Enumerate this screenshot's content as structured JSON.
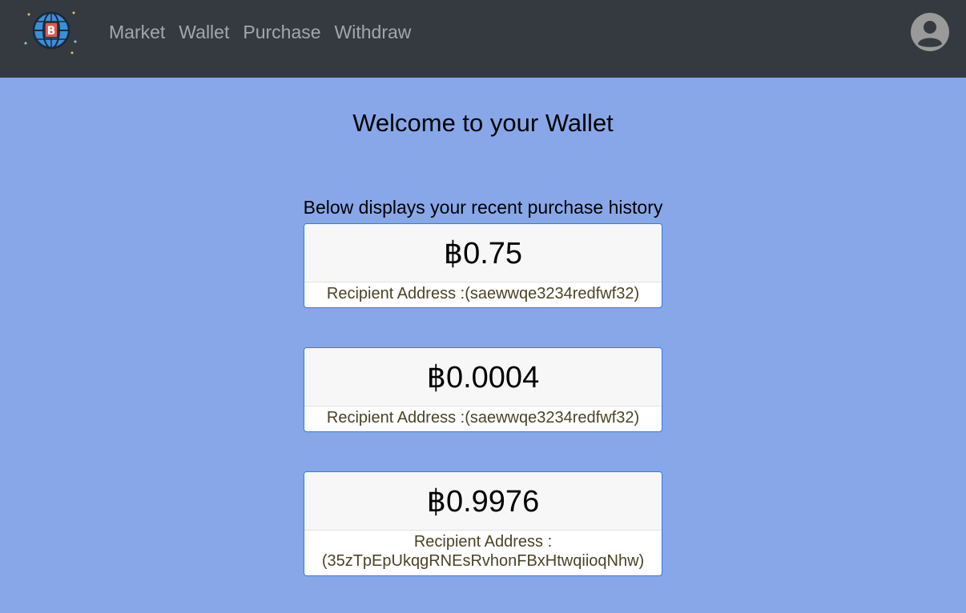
{
  "nav": {
    "links": [
      "Market",
      "Wallet",
      "Purchase",
      "Withdraw"
    ]
  },
  "main": {
    "title": "Welcome to your Wallet",
    "subtitle": "Below displays your recent purchase history",
    "transactions": [
      {
        "amount": "฿0.75",
        "recipient_label": "Recipient Address :",
        "recipient_address": "(saewwqe3234redfwf32)"
      },
      {
        "amount": "฿0.0004",
        "recipient_label": "Recipient Address :",
        "recipient_address": "(saewwqe3234redfwf32)"
      },
      {
        "amount": "฿0.9976",
        "recipient_label": "Recipient Address :",
        "recipient_address": "(35zTpEpUkqgRNEsRvhonFBxHtwqiioqNhw)"
      }
    ]
  },
  "colors": {
    "navbar_bg": "#343a40",
    "page_bg": "#87a7e8",
    "card_border": "#2e7bf6",
    "recipient_text": "#4b4326"
  },
  "icons": {
    "logo": "bitcoin-globe-icon",
    "profile": "user-avatar-icon"
  }
}
